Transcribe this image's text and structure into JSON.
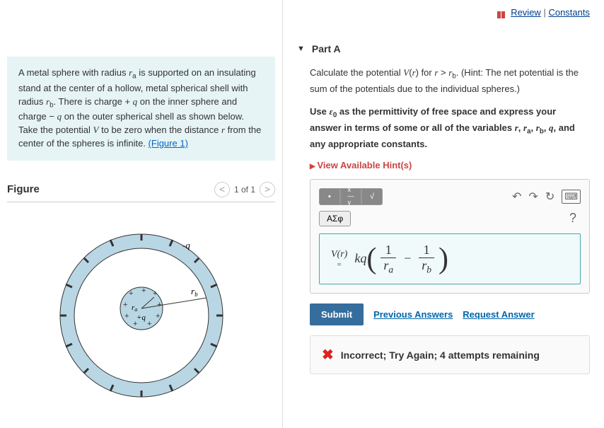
{
  "topLinks": {
    "review": "Review",
    "sep": "|",
    "constants": "Constants"
  },
  "problem": {
    "text_before_link": "A metal sphere with radius rₐ is supported on an insulating stand at the center of a hollow, metal spherical shell with radius r_b. There is charge + q on the inner sphere and charge − q on the outer spherical shell as shown below. Take the potential V to be zero when the distance r from the center of the spheres is infinite. ",
    "figure_link": "(Figure 1)"
  },
  "figure": {
    "title": "Figure",
    "pager": "1 of 1",
    "label_q": "-q",
    "label_rb": "r",
    "label_rb_sub": "b",
    "label_ra": "r",
    "label_ra_sub": "a",
    "label_pq": "+q"
  },
  "part": {
    "title": "Part A",
    "prompt_html": "Calculate the potential V(r) for r > r_b. (Hint: The net potential is the sum of the potentials due to the individual spheres.)",
    "prompt_bold": "Use ε₀ as the permittivity of free space and express your answer in terms of some or all of the variables r, rₐ, r_b, q, and any appropriate constants.",
    "hints": "View Available Hint(s)"
  },
  "toolbar": {
    "greek": "ΑΣφ"
  },
  "answer": {
    "lhs_top": "V(r)",
    "lhs_eq": "=",
    "kq": "kq",
    "one1": "1",
    "ra": "r",
    "ra_sub": "a",
    "minus": "−",
    "one2": "1",
    "rb": "r",
    "rb_sub": "b"
  },
  "buttons": {
    "submit": "Submit",
    "prev": "Previous Answers",
    "req": "Request Answer"
  },
  "feedback": {
    "text": "Incorrect; Try Again; 4 attempts remaining"
  }
}
